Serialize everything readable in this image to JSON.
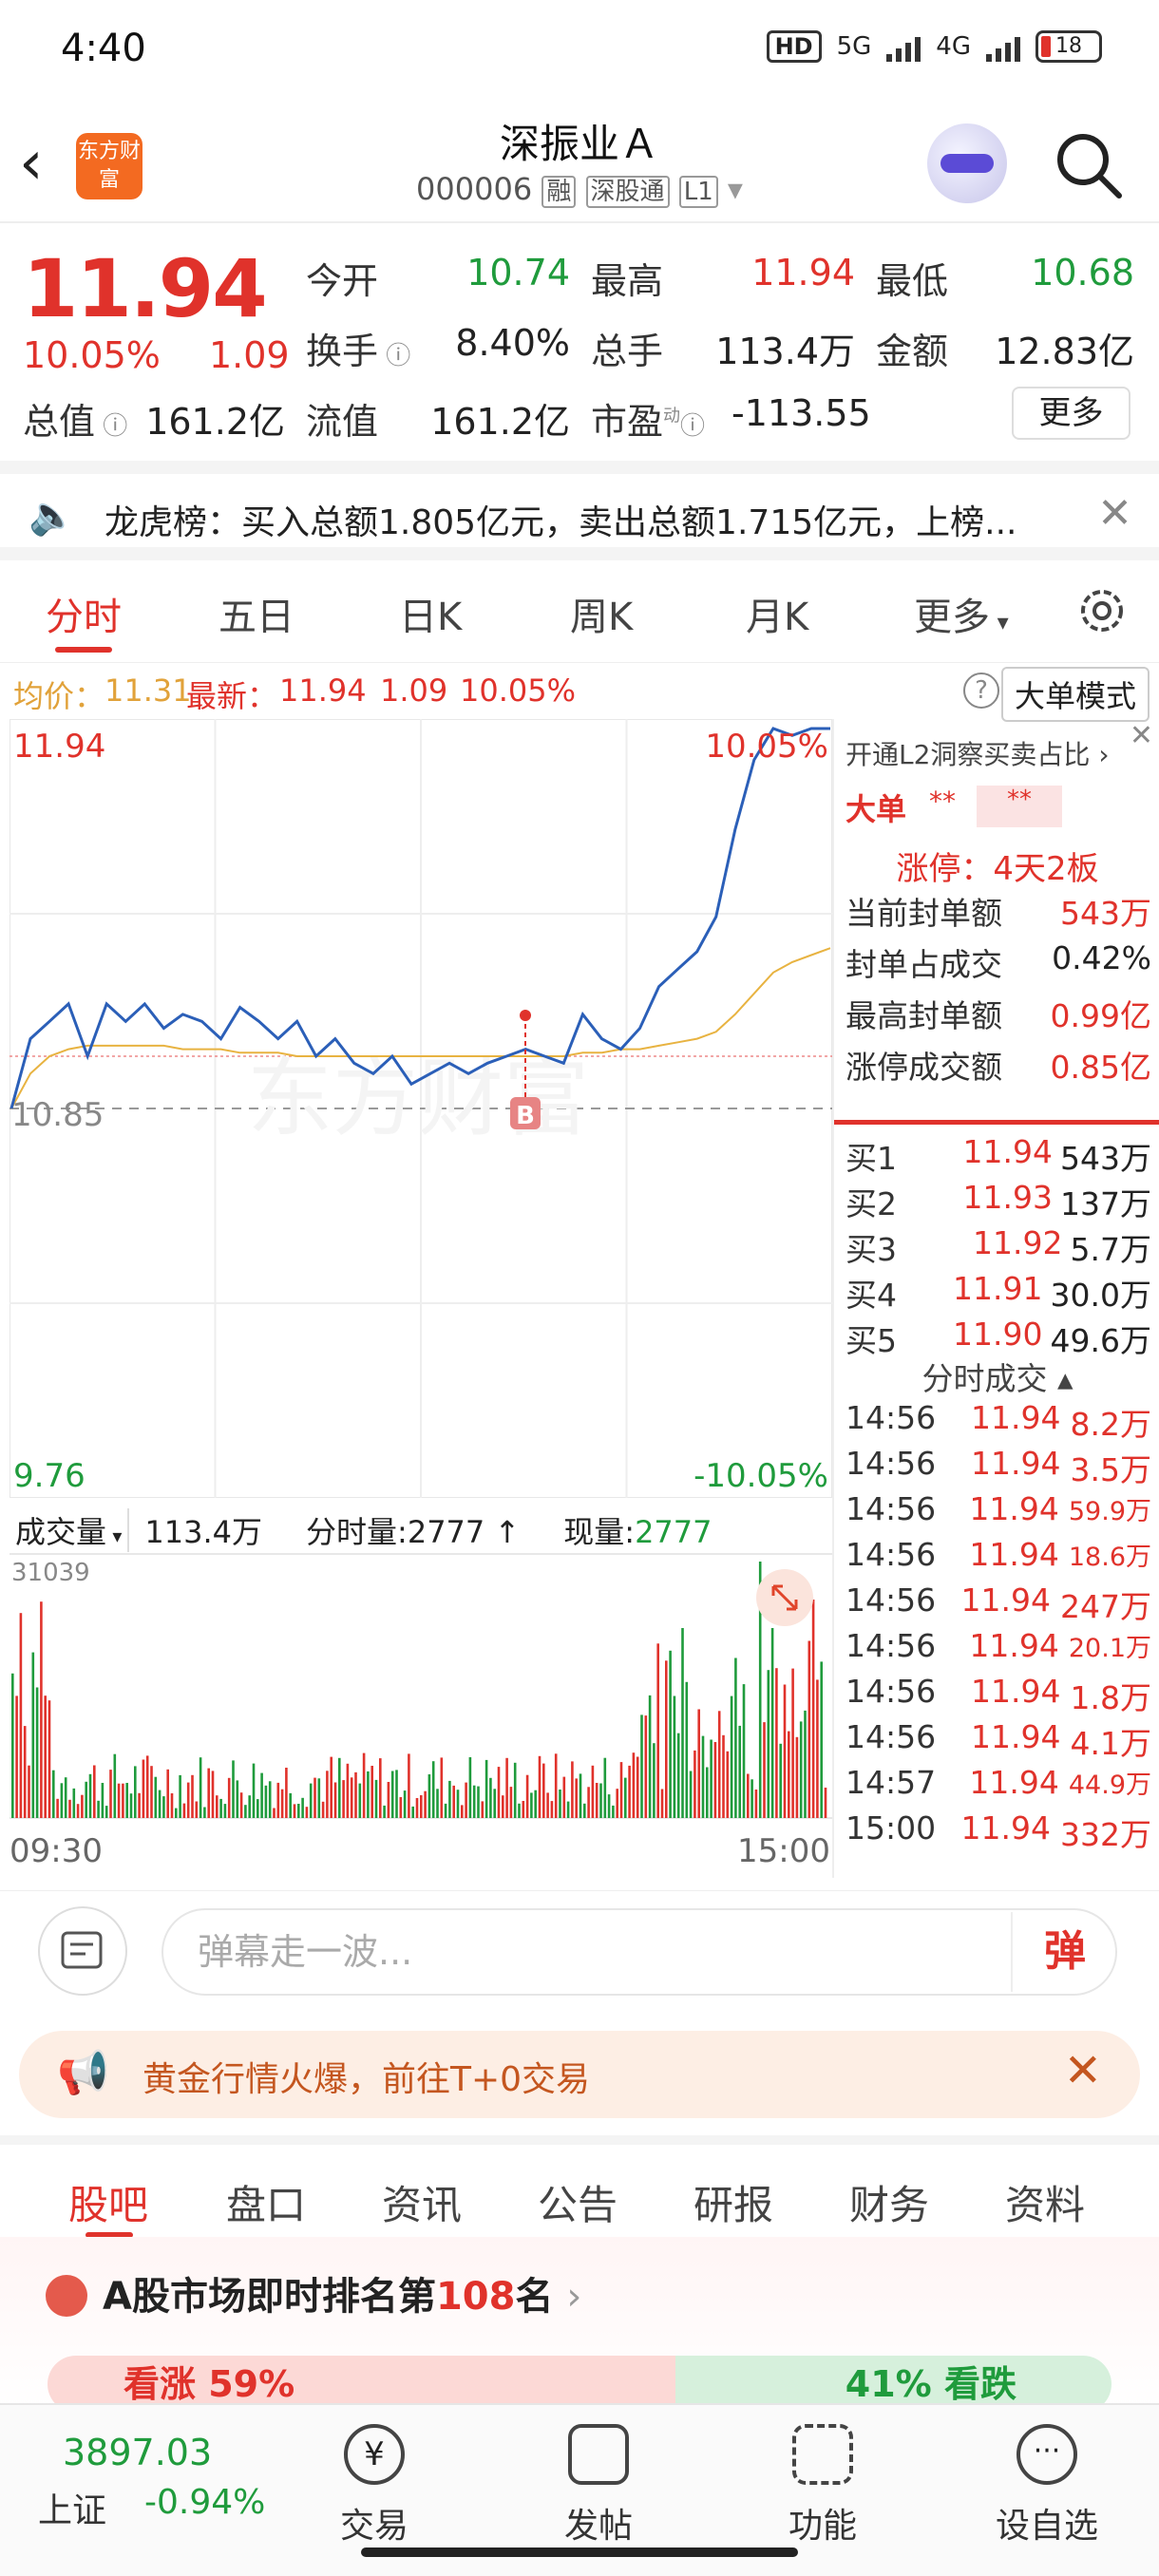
{
  "status": {
    "time": "4:40",
    "hd": "HD",
    "net1": "5G",
    "net2": "4G",
    "battery": "18"
  },
  "header": {
    "title": "深振业Ａ",
    "code": "000006",
    "tag1": "融",
    "tag2": "深股通",
    "tag3": "L1",
    "logo": "东方财富"
  },
  "quote": {
    "price": "11.94",
    "change_pct": "10.05%",
    "change_val": "1.09",
    "open_label": "今开",
    "open": "10.74",
    "high_label": "最高",
    "high": "11.94",
    "low_label": "最低",
    "low": "10.68",
    "turnover_label": "换手",
    "turnover": "8.40%",
    "vol_label": "总手",
    "vol": "113.4万",
    "amount_label": "金额",
    "amount": "12.83亿",
    "mktcap_label": "总值",
    "mktcap": "161.2亿",
    "float_label": "流值",
    "float": "161.2亿",
    "pe_label": "市盈",
    "pe_sup": "动",
    "pe": "-113.55",
    "more_label": "更多"
  },
  "notice": {
    "text": "龙虎榜：买入总额1.805亿元，卖出总额1.715亿元，上榜..."
  },
  "tabs": [
    "分时",
    "五日",
    "日K",
    "周K",
    "月K",
    "更多"
  ],
  "infoline": {
    "avg_label": "均价：",
    "avg": "11.31",
    "latest_label": "最新：",
    "latest": "11.94",
    "chg": "1.09",
    "pct": "10.05%",
    "big_order": "大单模式"
  },
  "chart_labels": {
    "top_price": "11.94",
    "top_pct": "10.05%",
    "mid_price": "10.85",
    "bottom_price": "9.76",
    "bottom_pct": "-10.05%",
    "marker": "B",
    "watermark": "东方财富",
    "vol_label": "成交量",
    "vol_total": "113.4万",
    "tick_label": "分时量:2777",
    "now_label": "现量:",
    "now_val": "2777",
    "vol_max": "31039",
    "t_start": "09:30",
    "t_end": "15:00"
  },
  "chart_data": {
    "type": "line",
    "x_start": "09:30",
    "x_end": "15:00",
    "ylim": [
      9.76,
      11.94
    ],
    "ref_price": 10.85,
    "series": [
      {
        "values": [
          10.85,
          11.05,
          11.1,
          11.15,
          11.0,
          11.15,
          11.1,
          11.15,
          11.08,
          11.12,
          11.1,
          11.05,
          11.14,
          11.1,
          11.05,
          11.1,
          11.0,
          11.05,
          10.98,
          10.95,
          11.0,
          10.92,
          10.95,
          10.98,
          10.95,
          10.98,
          11.0,
          11.02,
          11.0,
          10.98,
          11.12,
          11.05,
          11.02,
          11.08,
          11.2,
          11.25,
          11.3,
          11.4,
          11.65,
          11.85,
          11.94,
          11.92,
          11.94,
          11.94
        ]
      },
      {
        "values": [
          10.85,
          10.95,
          11.0,
          11.02,
          11.03,
          11.03,
          11.03,
          11.03,
          11.03,
          11.02,
          11.02,
          11.02,
          11.01,
          11.01,
          11.01,
          11.0,
          11.0,
          11.0,
          11.0,
          11.0,
          11.0,
          11.0,
          11.0,
          11.0,
          11.0,
          11.0,
          11.0,
          11.0,
          11.0,
          11.0,
          11.01,
          11.01,
          11.02,
          11.02,
          11.03,
          11.04,
          11.05,
          11.07,
          11.12,
          11.18,
          11.24,
          11.27,
          11.29,
          11.31
        ]
      }
    ]
  },
  "rpanel": {
    "l2": "开通L2洞察买卖占比",
    "big": "大单",
    "stars": "**",
    "limit": "涨停：4天2板",
    "rows": [
      {
        "k": "当前封单额",
        "v": "543万"
      },
      {
        "k": "封单占成交",
        "v": "0.42%"
      },
      {
        "k": "最高封单额",
        "v": "0.99亿"
      },
      {
        "k": "涨停成交额",
        "v": "0.85亿"
      }
    ],
    "bids": [
      {
        "k": "买1",
        "p": "11.94",
        "v": "543万"
      },
      {
        "k": "买2",
        "p": "11.93",
        "v": "137万"
      },
      {
        "k": "买3",
        "p": "11.92",
        "v": "5.7万"
      },
      {
        "k": "买4",
        "p": "11.91",
        "v": "30.0万"
      },
      {
        "k": "买5",
        "p": "11.90",
        "v": "49.6万"
      }
    ],
    "trades_title": "分时成交",
    "trades": [
      {
        "t": "14:56",
        "p": "11.94",
        "v": "8.2万"
      },
      {
        "t": "14:56",
        "p": "11.94",
        "v": "3.5万"
      },
      {
        "t": "14:56",
        "p": "11.94",
        "v": "59.9万"
      },
      {
        "t": "14:56",
        "p": "11.94",
        "v": "18.6万"
      },
      {
        "t": "14:56",
        "p": "11.94",
        "v": "247万"
      },
      {
        "t": "14:56",
        "p": "11.94",
        "v": "20.1万"
      },
      {
        "t": "14:56",
        "p": "11.94",
        "v": "1.8万"
      },
      {
        "t": "14:56",
        "p": "11.94",
        "v": "4.1万"
      },
      {
        "t": "14:57",
        "p": "11.94",
        "v": "44.9万"
      },
      {
        "t": "15:00",
        "p": "11.94",
        "v": "332万"
      }
    ]
  },
  "danmu": {
    "placeholder": "弹幕走一波...",
    "btn": "弹"
  },
  "gold": {
    "text": "黄金行情火爆，前往T+0交易"
  },
  "btabs": [
    "股吧",
    "盘口",
    "资讯",
    "公告",
    "研报",
    "财务",
    "资料"
  ],
  "rank": {
    "prefix": "A股市场即时排名第",
    "num": "108",
    "suffix": "名",
    "up": "看涨 59%",
    "down": "41% 看跌"
  },
  "bnav": {
    "index_val": "3897.03",
    "index_name": "上证",
    "index_chg": "-0.94%",
    "items": [
      "交易",
      "发帖",
      "功能",
      "设自选"
    ]
  }
}
